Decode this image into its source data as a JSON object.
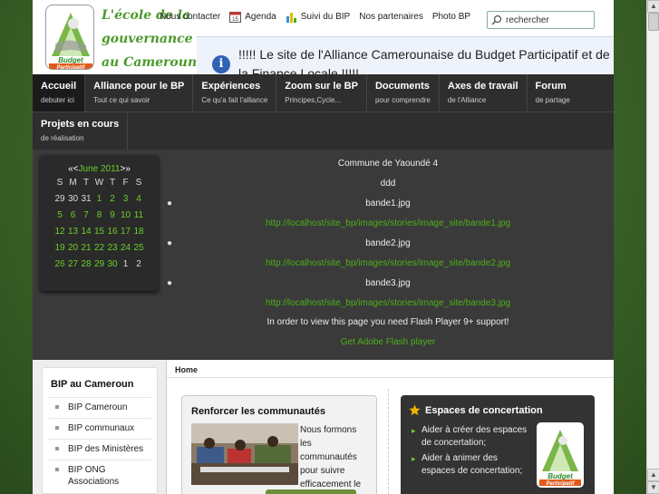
{
  "header": {
    "tagline": [
      "L'école de la",
      "gouvernance",
      "au Cameroun"
    ],
    "logo_text": [
      "Budget",
      "Participatif"
    ],
    "topnav": [
      {
        "label": "Nous contacter",
        "icon": "contact-icon"
      },
      {
        "label": "Agenda",
        "icon": "calendar-icon"
      },
      {
        "label": "Suivi du BIP",
        "icon": "chart-icon"
      },
      {
        "label": "Nos partenaires",
        "icon": ""
      },
      {
        "label": "Photo BP",
        "icon": ""
      }
    ],
    "search": {
      "placeholder": "rechercher",
      "value": "rechercher"
    },
    "banner_text": "!!!!! Le site de l'Alliance Camerounaise du Budget Participatif et de la Finance Locale !!!!!"
  },
  "mainnav": {
    "row1": [
      {
        "title": "Accueil",
        "sub": "debuter ici",
        "active": true
      },
      {
        "title": "Alliance pour le BP",
        "sub": "Tout ce qui savoir"
      },
      {
        "title": "Expériences",
        "sub": "Ce qu'a fait l'alliance"
      },
      {
        "title": "Zoom sur le BP",
        "sub": "Principes,Cycle..."
      },
      {
        "title": "Documents",
        "sub": "pour comprendre"
      },
      {
        "title": "Axes de travail",
        "sub": "de l'Alliance"
      },
      {
        "title": "Forum",
        "sub": "de partage"
      }
    ],
    "row2": [
      {
        "title": "Projets en cours",
        "sub": "de réalisation"
      }
    ]
  },
  "calendar": {
    "prev": "«<",
    "month": "June 2011",
    "next": ">»",
    "weekdays": [
      "S",
      "M",
      "T",
      "W",
      "T",
      "F",
      "S"
    ],
    "weeks": [
      [
        "29",
        "30",
        "31",
        "1",
        "2",
        "3",
        "4"
      ],
      [
        "5",
        "6",
        "7",
        "8",
        "9",
        "10",
        "11"
      ],
      [
        "12",
        "13",
        "14",
        "15",
        "16",
        "17",
        "18"
      ],
      [
        "19",
        "20",
        "21",
        "22",
        "23",
        "24",
        "25"
      ],
      [
        "26",
        "27",
        "28",
        "29",
        "30",
        "1",
        "2"
      ]
    ]
  },
  "slides": {
    "title": "Commune de Yaoundé 4",
    "subtitle": "ddd",
    "items": [
      {
        "name": "bande1.jpg",
        "url": "http://localhost/site_bp/images/stories/image_site/bande1.jpg"
      },
      {
        "name": "bande2.jpg",
        "url": "http://localhost/site_bp/images/stories/image_site/bande2.jpg"
      },
      {
        "name": "bande3.jpg",
        "url": "http://localhost/site_bp/images/stories/image_site/bande3.jpg"
      }
    ],
    "flash_msg": "In order to view this page you need Flash Player 9+ support!",
    "flash_link": "Get Adobe Flash player"
  },
  "sidebar": {
    "title": "BIP au Cameroun",
    "items": [
      "BIP Cameroun",
      "BIP communaux",
      "BIP des Ministères",
      "BIP ONG Associations"
    ]
  },
  "breadcrumb": "Home",
  "panel_left": {
    "title": "Renforcer les communautés",
    "text": "Nous formons les communautés pour suivre efficacement le"
  },
  "panel_right": {
    "title": "Espaces de concertation",
    "items": [
      "Aider à créer des espaces de concertation;",
      "Aider à animer des espaces de concertation;"
    ]
  },
  "colors": {
    "accent_green": "#6ccf2a",
    "nav_dark": "#2e2e2e",
    "banner_bg": "#eef3fb"
  }
}
